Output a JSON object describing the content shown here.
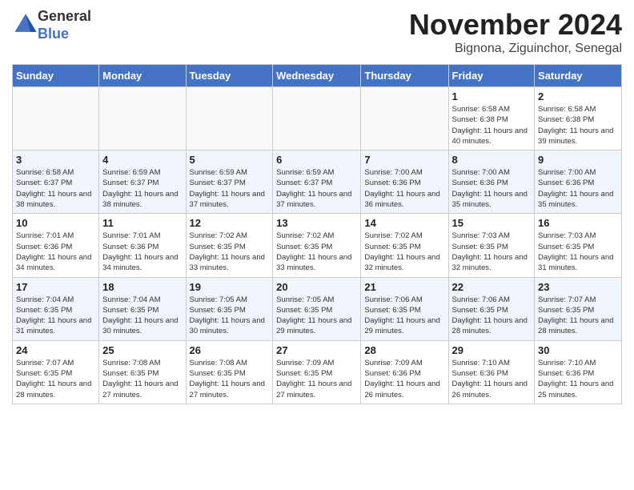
{
  "logo": {
    "general": "General",
    "blue": "Blue"
  },
  "header": {
    "month": "November 2024",
    "location": "Bignona, Ziguinchor, Senegal"
  },
  "weekdays": [
    "Sunday",
    "Monday",
    "Tuesday",
    "Wednesday",
    "Thursday",
    "Friday",
    "Saturday"
  ],
  "weeks": [
    [
      {
        "day": "",
        "info": ""
      },
      {
        "day": "",
        "info": ""
      },
      {
        "day": "",
        "info": ""
      },
      {
        "day": "",
        "info": ""
      },
      {
        "day": "",
        "info": ""
      },
      {
        "day": "1",
        "info": "Sunrise: 6:58 AM\nSunset: 6:38 PM\nDaylight: 11 hours and 40 minutes."
      },
      {
        "day": "2",
        "info": "Sunrise: 6:58 AM\nSunset: 6:38 PM\nDaylight: 11 hours and 39 minutes."
      }
    ],
    [
      {
        "day": "3",
        "info": "Sunrise: 6:58 AM\nSunset: 6:37 PM\nDaylight: 11 hours and 38 minutes."
      },
      {
        "day": "4",
        "info": "Sunrise: 6:59 AM\nSunset: 6:37 PM\nDaylight: 11 hours and 38 minutes."
      },
      {
        "day": "5",
        "info": "Sunrise: 6:59 AM\nSunset: 6:37 PM\nDaylight: 11 hours and 37 minutes."
      },
      {
        "day": "6",
        "info": "Sunrise: 6:59 AM\nSunset: 6:37 PM\nDaylight: 11 hours and 37 minutes."
      },
      {
        "day": "7",
        "info": "Sunrise: 7:00 AM\nSunset: 6:36 PM\nDaylight: 11 hours and 36 minutes."
      },
      {
        "day": "8",
        "info": "Sunrise: 7:00 AM\nSunset: 6:36 PM\nDaylight: 11 hours and 35 minutes."
      },
      {
        "day": "9",
        "info": "Sunrise: 7:00 AM\nSunset: 6:36 PM\nDaylight: 11 hours and 35 minutes."
      }
    ],
    [
      {
        "day": "10",
        "info": "Sunrise: 7:01 AM\nSunset: 6:36 PM\nDaylight: 11 hours and 34 minutes."
      },
      {
        "day": "11",
        "info": "Sunrise: 7:01 AM\nSunset: 6:36 PM\nDaylight: 11 hours and 34 minutes."
      },
      {
        "day": "12",
        "info": "Sunrise: 7:02 AM\nSunset: 6:35 PM\nDaylight: 11 hours and 33 minutes."
      },
      {
        "day": "13",
        "info": "Sunrise: 7:02 AM\nSunset: 6:35 PM\nDaylight: 11 hours and 33 minutes."
      },
      {
        "day": "14",
        "info": "Sunrise: 7:02 AM\nSunset: 6:35 PM\nDaylight: 11 hours and 32 minutes."
      },
      {
        "day": "15",
        "info": "Sunrise: 7:03 AM\nSunset: 6:35 PM\nDaylight: 11 hours and 32 minutes."
      },
      {
        "day": "16",
        "info": "Sunrise: 7:03 AM\nSunset: 6:35 PM\nDaylight: 11 hours and 31 minutes."
      }
    ],
    [
      {
        "day": "17",
        "info": "Sunrise: 7:04 AM\nSunset: 6:35 PM\nDaylight: 11 hours and 31 minutes."
      },
      {
        "day": "18",
        "info": "Sunrise: 7:04 AM\nSunset: 6:35 PM\nDaylight: 11 hours and 30 minutes."
      },
      {
        "day": "19",
        "info": "Sunrise: 7:05 AM\nSunset: 6:35 PM\nDaylight: 11 hours and 30 minutes."
      },
      {
        "day": "20",
        "info": "Sunrise: 7:05 AM\nSunset: 6:35 PM\nDaylight: 11 hours and 29 minutes."
      },
      {
        "day": "21",
        "info": "Sunrise: 7:06 AM\nSunset: 6:35 PM\nDaylight: 11 hours and 29 minutes."
      },
      {
        "day": "22",
        "info": "Sunrise: 7:06 AM\nSunset: 6:35 PM\nDaylight: 11 hours and 28 minutes."
      },
      {
        "day": "23",
        "info": "Sunrise: 7:07 AM\nSunset: 6:35 PM\nDaylight: 11 hours and 28 minutes."
      }
    ],
    [
      {
        "day": "24",
        "info": "Sunrise: 7:07 AM\nSunset: 6:35 PM\nDaylight: 11 hours and 28 minutes."
      },
      {
        "day": "25",
        "info": "Sunrise: 7:08 AM\nSunset: 6:35 PM\nDaylight: 11 hours and 27 minutes."
      },
      {
        "day": "26",
        "info": "Sunrise: 7:08 AM\nSunset: 6:35 PM\nDaylight: 11 hours and 27 minutes."
      },
      {
        "day": "27",
        "info": "Sunrise: 7:09 AM\nSunset: 6:35 PM\nDaylight: 11 hours and 27 minutes."
      },
      {
        "day": "28",
        "info": "Sunrise: 7:09 AM\nSunset: 6:36 PM\nDaylight: 11 hours and 26 minutes."
      },
      {
        "day": "29",
        "info": "Sunrise: 7:10 AM\nSunset: 6:36 PM\nDaylight: 11 hours and 26 minutes."
      },
      {
        "day": "30",
        "info": "Sunrise: 7:10 AM\nSunset: 6:36 PM\nDaylight: 11 hours and 25 minutes."
      }
    ]
  ]
}
